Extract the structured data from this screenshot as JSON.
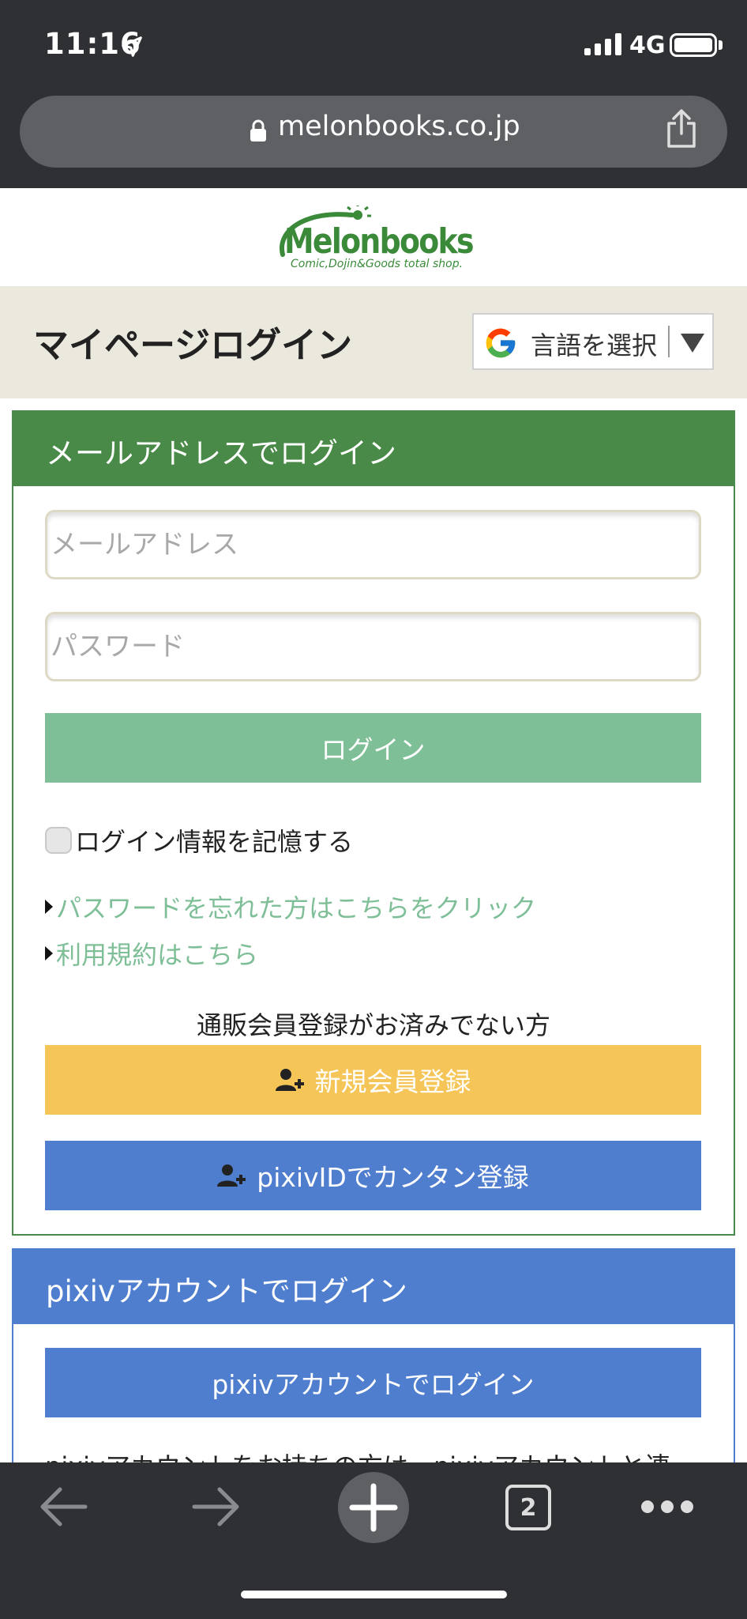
{
  "status_bar": {
    "time": "11:16",
    "network": "4G",
    "icons": [
      "location-arrow-icon",
      "signal-bars-icon",
      "battery-icon"
    ]
  },
  "browser": {
    "url": "melonbooks.co.jp",
    "icons": [
      "lock-icon",
      "share-icon"
    ],
    "tab_count": "2"
  },
  "site": {
    "logo_text": "Melonbooks",
    "logo_tagline": "Comic,Dojin&Goods total shop.",
    "page_title": "マイページログイン",
    "language_select": "言語を選択"
  },
  "email_login": {
    "heading": "メールアドレスでログイン",
    "email_placeholder": "メールアドレス",
    "password_placeholder": "パスワード",
    "login_button": "ログイン",
    "remember_label": "ログイン情報を記憶する",
    "remember_checked": false,
    "forgot_link": "パスワードを忘れた方はこちらをクリック",
    "terms_link": "利用規約はこちら",
    "register_note": "通販会員登録がお済みでない方",
    "register_button": "新規会員登録",
    "pixiv_register_button": "pixivIDでカンタン登録"
  },
  "pixiv_login": {
    "heading": "pixivアカウントでログイン",
    "button": "pixivアカウントでログイン",
    "description": "pixivアカウントをお持ちの方は、pixivアカウントと連"
  },
  "colors": {
    "green": "#4a8a48",
    "login_button": "#7fbf98",
    "register_button": "#f5c557",
    "pixiv_blue": "#507ecf",
    "title_bar": "#ebe9dd",
    "chrome": "#2f3034"
  }
}
